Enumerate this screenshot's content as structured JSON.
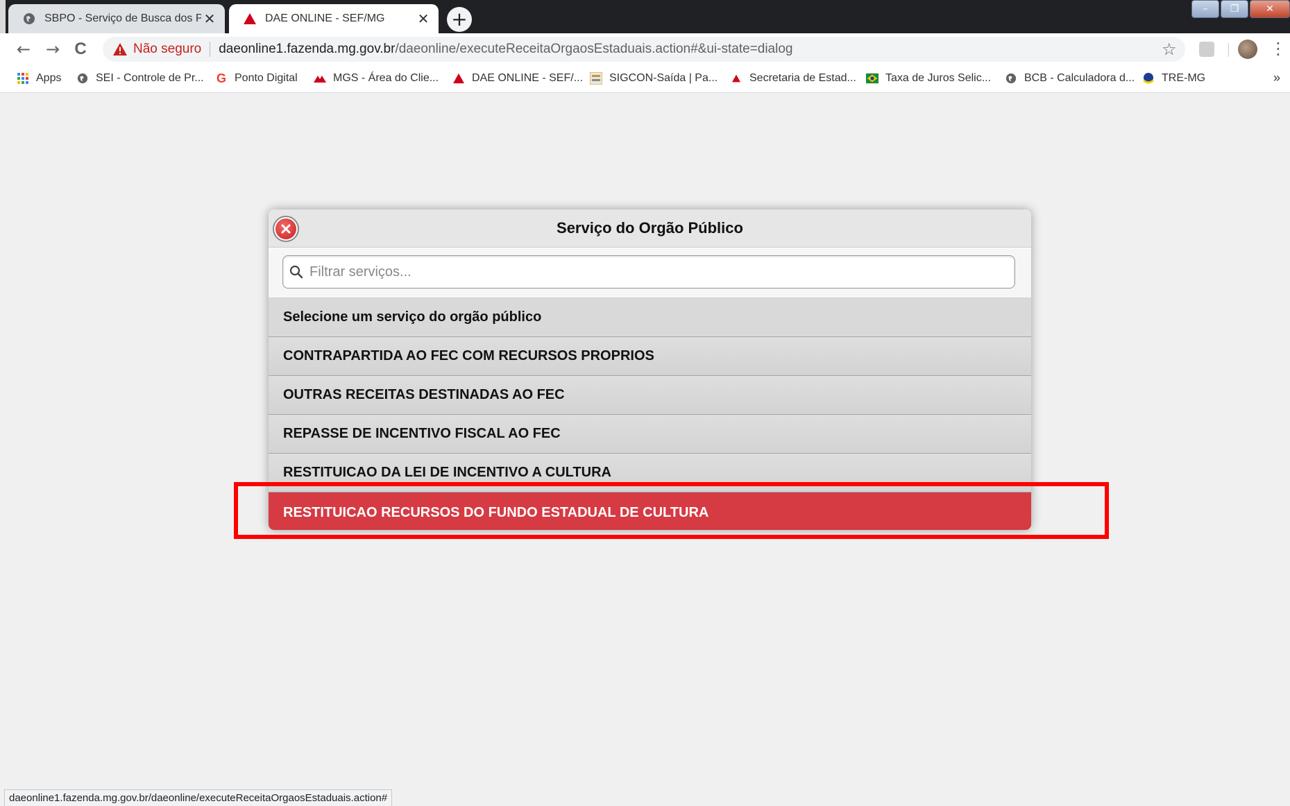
{
  "browser": {
    "tabs": [
      {
        "label": "SBPO - Serviço de Busca dos Pag",
        "close": "✕",
        "active": false,
        "icon": "globe-icon"
      },
      {
        "label": "DAE ONLINE - SEF/MG",
        "close": "✕",
        "active": true,
        "icon": "red-triangle-icon"
      }
    ],
    "new_tab": "+",
    "window_buttons": {
      "minimize": "–",
      "restore": "❐",
      "close": "✕"
    },
    "nav": {
      "back": "←",
      "forward": "→",
      "reload": "C"
    },
    "address": {
      "security_label": "Não seguro",
      "url_host": "daeonline1.fazenda.mg.gov.br",
      "url_path": "/daeonline/executeReceitaOrgaosEstaduais.action#&ui-state=dialog"
    },
    "star": "☆",
    "menu": "⋮",
    "bookmarks": [
      {
        "label": "Apps",
        "icon": "apps-grid-icon"
      },
      {
        "label": "SEI - Controle de Pr...",
        "icon": "globe-icon"
      },
      {
        "label": "Ponto Digital",
        "icon": "google-g-icon"
      },
      {
        "label": "MGS - Área do Clie...",
        "icon": "mgs-logo-icon"
      },
      {
        "label": "DAE ONLINE - SEF/...",
        "icon": "red-triangle-icon"
      },
      {
        "label": "SIGCON-Saída | Pa...",
        "icon": "sigcon-logo-icon"
      },
      {
        "label": "Secretaria de Estad...",
        "icon": "red-triangle-icon"
      },
      {
        "label": "Taxa de Juros Selic...",
        "icon": "brazil-flag-icon"
      },
      {
        "label": "BCB - Calculadora d...",
        "icon": "globe-icon"
      },
      {
        "label": "TRE-MG",
        "icon": "tre-logo-icon"
      }
    ],
    "bookmarks_more": "»",
    "status_url": "daeonline1.fazenda.mg.gov.br/daeonline/executeReceitaOrgaosEstaduais.action#"
  },
  "dialog": {
    "title": "Serviço do Orgão Público",
    "filter_placeholder": "Filtrar serviços...",
    "list_header": "Selecione um serviço do orgão público",
    "items": [
      {
        "label": "CONTRAPARTIDA AO FEC COM RECURSOS PROPRIOS",
        "selected": false
      },
      {
        "label": "OUTRAS RECEITAS DESTINADAS AO FEC",
        "selected": false
      },
      {
        "label": "REPASSE DE INCENTIVO FISCAL AO FEC",
        "selected": false
      },
      {
        "label": "RESTITUICAO DA LEI DE INCENTIVO A CULTURA",
        "selected": false
      },
      {
        "label": "RESTITUICAO RECURSOS DO FUNDO ESTADUAL DE CULTURA",
        "selected": true
      }
    ]
  },
  "colors": {
    "selected_item": "#d63a43",
    "highlight_border": "#ff0000",
    "not_secure": "#c5221f"
  }
}
